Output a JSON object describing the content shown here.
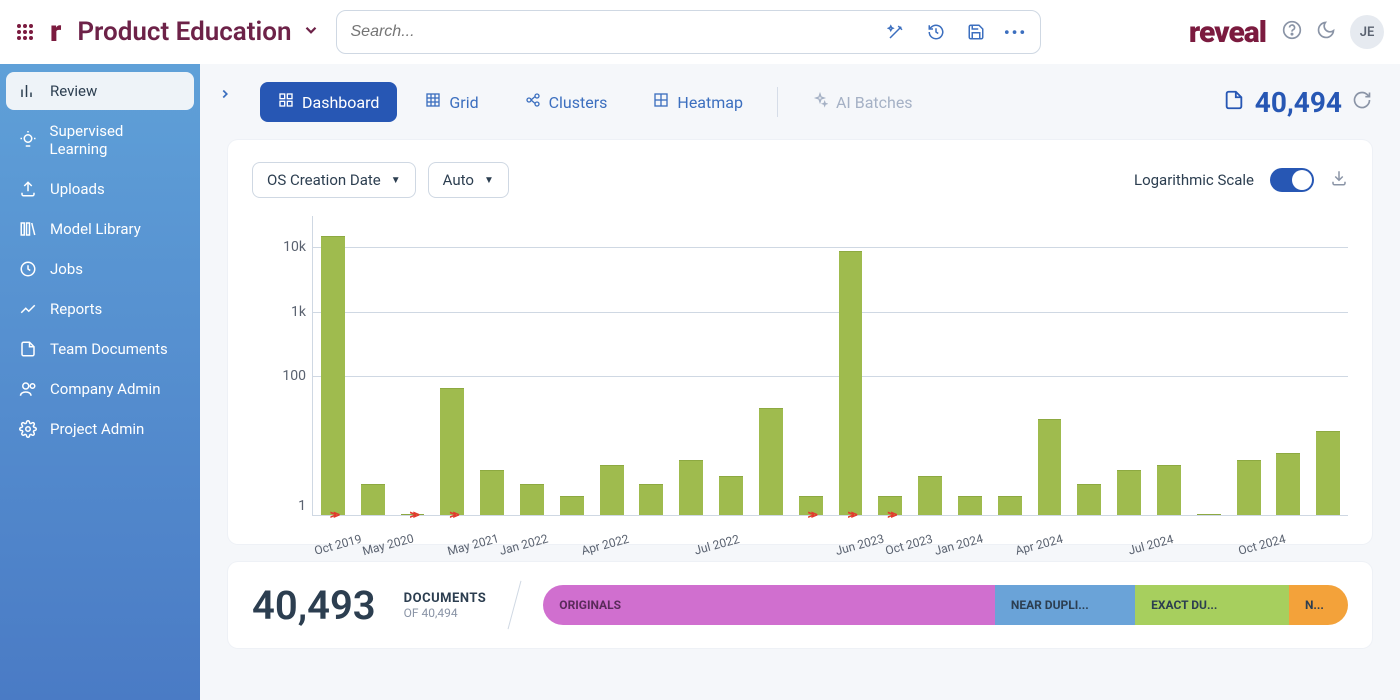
{
  "brand": {
    "r": "r",
    "logo": "reveal",
    "avatar": "JE"
  },
  "project": {
    "title": "Product Education"
  },
  "search": {
    "placeholder": "Search..."
  },
  "sidebar": {
    "items": [
      {
        "label": "Review"
      },
      {
        "label": "Supervised Learning"
      },
      {
        "label": "Uploads"
      },
      {
        "label": "Model Library"
      },
      {
        "label": "Jobs"
      },
      {
        "label": "Reports"
      },
      {
        "label": "Team Documents"
      },
      {
        "label": "Company Admin"
      },
      {
        "label": "Project Admin"
      }
    ]
  },
  "tabs": {
    "dashboard": "Dashboard",
    "grid": "Grid",
    "clusters": "Clusters",
    "heatmap": "Heatmap",
    "ai": "AI Batches"
  },
  "records": {
    "label": "40,494"
  },
  "dashboard": {
    "field_dd": "OS Creation Date",
    "interval_dd": "Auto",
    "log_label": "Logarithmic Scale"
  },
  "summary": {
    "count": "40,493",
    "word": "DOCUMENTS",
    "of": "OF 40,494"
  },
  "dup": {
    "originals": "ORIGINALS",
    "near": "NEAR DUPLI...",
    "exact": "EXACT DU...",
    "n": "N..."
  },
  "chart_data": {
    "type": "bar",
    "yscale": "log",
    "yticks": [
      "1",
      "100",
      "1k",
      "10k"
    ],
    "ylim": [
      1,
      30000
    ],
    "columns": [
      {
        "label": "Oct 2019",
        "value": 20000,
        "gap_after": true
      },
      {
        "label": "May 2020",
        "value": 3,
        "no_label": false
      },
      {
        "value": 1,
        "no_label": true,
        "gap_after": true
      },
      {
        "label": "May 2021",
        "value": 90,
        "gap_after": true
      },
      {
        "label": "Jan 2022",
        "value": 5,
        "no_label": false
      },
      {
        "value": 3,
        "no_label": true
      },
      {
        "label": "Apr 2022",
        "value": 2,
        "no_label": false
      },
      {
        "value": 6,
        "no_label": true
      },
      {
        "value": 3,
        "no_label": true
      },
      {
        "label": "Jul 2022",
        "value": 7,
        "no_label": false
      },
      {
        "value": 4,
        "no_label": true
      },
      {
        "value": 45,
        "no_label": true
      },
      {
        "value": 2,
        "no_label": true,
        "gap_after": true
      },
      {
        "label": "Jun 2023",
        "value": 12000,
        "gap_after": true
      },
      {
        "label": "Oct 2023",
        "value": 2,
        "gap_after": true
      },
      {
        "label": "Jan 2024",
        "value": 4,
        "no_label": false
      },
      {
        "value": 2,
        "no_label": true
      },
      {
        "label": "Apr 2024",
        "value": 2,
        "no_label": false
      },
      {
        "value": 30,
        "no_label": true
      },
      {
        "value": 3,
        "no_label": true
      },
      {
        "label": "Jul 2024",
        "value": 5,
        "no_label": false
      },
      {
        "value": 6,
        "no_label": true
      },
      {
        "value": 1,
        "no_label": true
      },
      {
        "label": "Oct 2024",
        "value": 7,
        "no_label": false
      },
      {
        "value": 9,
        "no_label": true
      },
      {
        "value": 20,
        "no_label": true
      }
    ]
  }
}
